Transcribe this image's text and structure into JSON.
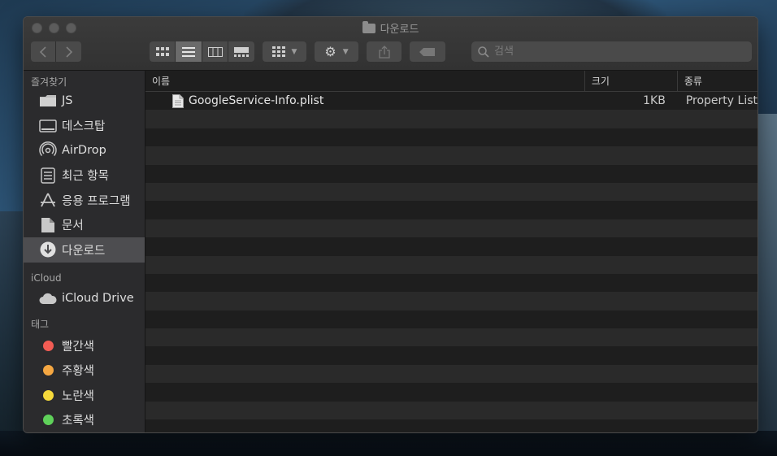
{
  "window": {
    "title": "다운로드"
  },
  "search": {
    "placeholder": "검색"
  },
  "sidebar": {
    "favorites_header": "즐겨찾기",
    "favorites": [
      {
        "label": "JS",
        "icon": "folder-icon"
      },
      {
        "label": "데스크탑",
        "icon": "desktop-icon"
      },
      {
        "label": "AirDrop",
        "icon": "airdrop-icon"
      },
      {
        "label": "최근 항목",
        "icon": "recents-icon"
      },
      {
        "label": "응용 프로그램",
        "icon": "applications-icon"
      },
      {
        "label": "문서",
        "icon": "documents-icon"
      },
      {
        "label": "다운로드",
        "icon": "downloads-icon",
        "selected": true
      }
    ],
    "icloud_header": "iCloud",
    "icloud": [
      {
        "label": "iCloud Drive",
        "icon": "cloud-icon"
      }
    ],
    "tags_header": "태그",
    "tags": [
      {
        "label": "빨간색",
        "color": "#f25c54"
      },
      {
        "label": "주황색",
        "color": "#f5a742"
      },
      {
        "label": "노란색",
        "color": "#f5d93b"
      },
      {
        "label": "초록색",
        "color": "#5fd15a"
      }
    ]
  },
  "columns": {
    "name": "이름",
    "size": "크기",
    "kind": "종류"
  },
  "files": [
    {
      "name": "GoogleService-Info.plist",
      "size": "1KB",
      "kind": "Property List",
      "icon": "plist-file-icon"
    }
  ],
  "colors": {
    "selection": "#4d4d50",
    "window_bg": "#1e1e1e",
    "sidebar_bg": "#2b2b2d"
  }
}
